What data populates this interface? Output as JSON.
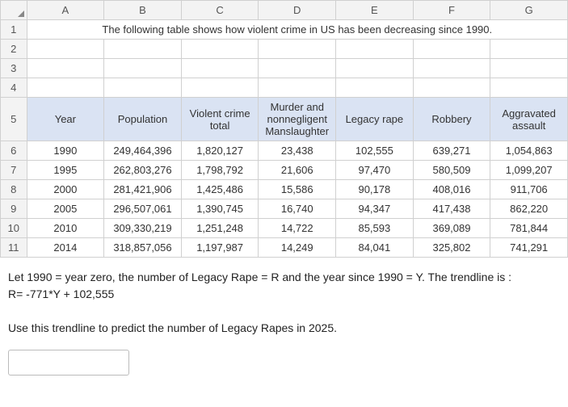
{
  "cols": [
    "A",
    "B",
    "C",
    "D",
    "E",
    "F",
    "G"
  ],
  "rows_blank": [
    "1",
    "2",
    "3",
    "4"
  ],
  "title": "The following table shows how  violent crime in US has been decreasing since 1990.",
  "headers": {
    "row_label": "5",
    "year": "Year",
    "population": "Population",
    "violent": "Violent crime total",
    "murder": "Murder and nonnegligent Manslaughter",
    "rape": "Legacy rape",
    "robbery": "Robbery",
    "assault": "Aggravated assault"
  },
  "data_rows": [
    {
      "n": "6",
      "year": "1990",
      "pop": "249,464,396",
      "viol": "1,820,127",
      "mur": "23,438",
      "rape": "102,555",
      "rob": "639,271",
      "asl": "1,054,863"
    },
    {
      "n": "7",
      "year": "1995",
      "pop": "262,803,276",
      "viol": "1,798,792",
      "mur": "21,606",
      "rape": "97,470",
      "rob": "580,509",
      "asl": "1,099,207"
    },
    {
      "n": "8",
      "year": "2000",
      "pop": "281,421,906",
      "viol": "1,425,486",
      "mur": "15,586",
      "rape": "90,178",
      "rob": "408,016",
      "asl": "911,706"
    },
    {
      "n": "9",
      "year": "2005",
      "pop": "296,507,061",
      "viol": "1,390,745",
      "mur": "16,740",
      "rape": "94,347",
      "rob": "417,438",
      "asl": "862,220"
    },
    {
      "n": "10",
      "year": "2010",
      "pop": "309,330,219",
      "viol": "1,251,248",
      "mur": "14,722",
      "rape": "85,593",
      "rob": "369,089",
      "asl": "781,844"
    },
    {
      "n": "11",
      "year": "2014",
      "pop": "318,857,056",
      "viol": "1,197,987",
      "mur": "14,249",
      "rape": "84,041",
      "rob": "325,802",
      "asl": "741,291"
    }
  ],
  "question": {
    "line1": "Let 1990 = year zero, the number of Legacy Rape = R and the year since 1990 = Y. The trendline is :",
    "line2": "R= -771*Y + 102,555",
    "line3": "Use this trendline to predict the number of Legacy Rapes in 2025."
  },
  "answer_placeholder": ""
}
